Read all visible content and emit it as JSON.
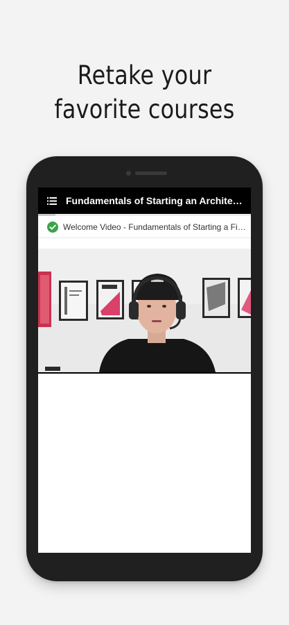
{
  "headline": {
    "line1": "Retake your",
    "line2": "favorite courses"
  },
  "app": {
    "menu_icon": "list-menu-icon",
    "title": "Fundamentals of Starting an Architecture Firm",
    "progress_fraction": 0.08
  },
  "lesson": {
    "status_icon": "check-circle-icon",
    "status_color": "#3aa44a",
    "title": "Welcome Video - Fundamentals of Starting a Firm"
  },
  "colors": {
    "background": "#f3f3f4",
    "phone_body": "#202020",
    "app_bar": "#000000",
    "poster_accent": "#d9406a"
  }
}
